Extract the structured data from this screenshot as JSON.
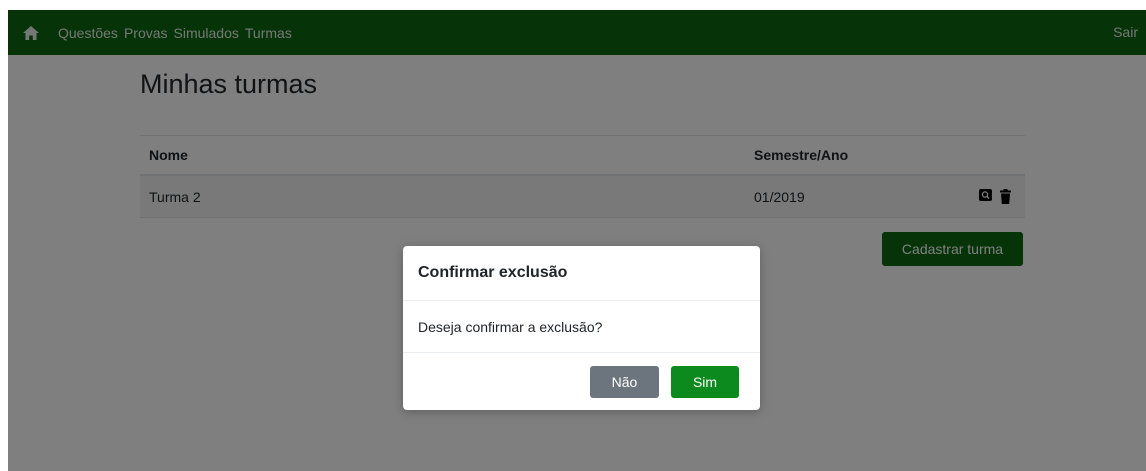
{
  "navbar": {
    "home_icon": "home-icon",
    "links": [
      "Questões",
      "Provas",
      "Simulados",
      "Turmas"
    ],
    "logout_label": "Sair"
  },
  "page": {
    "title": "Minhas turmas"
  },
  "table": {
    "columns": [
      "Nome",
      "Semestre/Ano"
    ],
    "rows": [
      {
        "name": "Turma 2",
        "semester": "01/2019",
        "actions": [
          "view-icon",
          "trash-icon"
        ]
      }
    ]
  },
  "register_button_label": "Cadastrar turma",
  "modal": {
    "title": "Confirmar exclusão",
    "body": "Deseja confirmar a exclusão?",
    "no_label": "Não",
    "yes_label": "Sim"
  },
  "colors": {
    "brand_green": "#0c6610",
    "confirm_green": "#0c8a1e",
    "secondary_gray": "#6c757d"
  }
}
